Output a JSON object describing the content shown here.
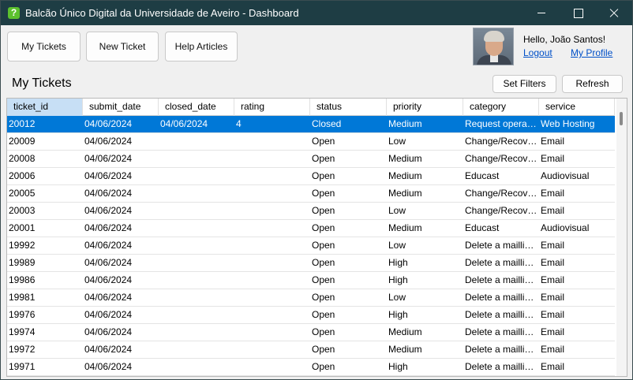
{
  "window": {
    "title": "Balcão Único Digital da Universidade de Aveiro - Dashboard",
    "icon_glyph": "?"
  },
  "nav": {
    "my_tickets": "My Tickets",
    "new_ticket": "New Ticket",
    "help_articles": "Help Articles"
  },
  "user": {
    "greeting": "Hello, João Santos!",
    "logout": "Logout",
    "my_profile": "My Profile"
  },
  "main": {
    "title": "My Tickets",
    "set_filters": "Set Filters",
    "refresh": "Refresh"
  },
  "table": {
    "columns": [
      "ticket_id",
      "submit_date",
      "closed_date",
      "rating",
      "status",
      "priority",
      "category",
      "service"
    ],
    "selected_row": 0,
    "rows": [
      [
        "20012",
        "04/06/2024",
        "04/06/2024",
        "4",
        "Closed",
        "Medium",
        "Request operati...",
        "Web Hosting"
      ],
      [
        "20009",
        "04/06/2024",
        "",
        "",
        "Open",
        "Low",
        "Change/Recove...",
        "Email"
      ],
      [
        "20008",
        "04/06/2024",
        "",
        "",
        "Open",
        "Medium",
        "Change/Recove...",
        "Email"
      ],
      [
        "20006",
        "04/06/2024",
        "",
        "",
        "Open",
        "Medium",
        "Educast",
        "Audiovisual"
      ],
      [
        "20005",
        "04/06/2024",
        "",
        "",
        "Open",
        "Medium",
        "Change/Recove...",
        "Email"
      ],
      [
        "20003",
        "04/06/2024",
        "",
        "",
        "Open",
        "Low",
        "Change/Recove...",
        "Email"
      ],
      [
        "20001",
        "04/06/2024",
        "",
        "",
        "Open",
        "Medium",
        "Educast",
        "Audiovisual"
      ],
      [
        "19992",
        "04/06/2024",
        "",
        "",
        "Open",
        "Low",
        "Delete a mailling ...",
        "Email"
      ],
      [
        "19989",
        "04/06/2024",
        "",
        "",
        "Open",
        "High",
        "Delete a mailling ...",
        "Email"
      ],
      [
        "19986",
        "04/06/2024",
        "",
        "",
        "Open",
        "High",
        "Delete a mailling ...",
        "Email"
      ],
      [
        "19981",
        "04/06/2024",
        "",
        "",
        "Open",
        "Low",
        "Delete a mailling ...",
        "Email"
      ],
      [
        "19976",
        "04/06/2024",
        "",
        "",
        "Open",
        "High",
        "Delete a mailling ...",
        "Email"
      ],
      [
        "19974",
        "04/06/2024",
        "",
        "",
        "Open",
        "Medium",
        "Delete a mailling ...",
        "Email"
      ],
      [
        "19972",
        "04/06/2024",
        "",
        "",
        "Open",
        "Medium",
        "Delete a mailling ...",
        "Email"
      ],
      [
        "19971",
        "04/06/2024",
        "",
        "",
        "Open",
        "High",
        "Delete a mailling ...",
        "Email"
      ]
    ]
  },
  "colors": {
    "titlebar": "#1e3d44",
    "selection": "#0078d7",
    "header_selected": "#c7dff5",
    "link": "#0050c8",
    "app_icon": "#5cc12e"
  }
}
